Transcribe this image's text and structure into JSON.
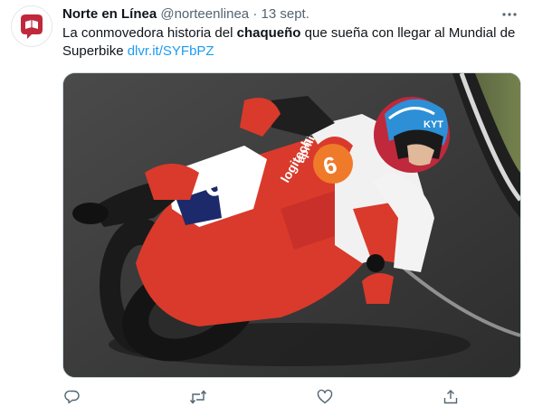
{
  "tweet": {
    "author_name": "Norte en Línea",
    "handle": "@norteenlinea",
    "separator": "·",
    "date": "13 sept.",
    "text_before": "La conmovedora historia del ",
    "text_bold": "chaqueño",
    "text_after": " que sueña con llegar al Mundial de Superbike ",
    "link": "dlvr.it/SYFbPZ"
  },
  "media": {
    "bike_number": "6",
    "helmet_logo": "KYT",
    "sponsor_logo": "logitech",
    "sponsor_brand": "aprilia"
  },
  "icons": {
    "avatar": "norte-en-linea-logo-icon",
    "more": "more-options-icon",
    "reply": "reply-icon",
    "retweet": "retweet-icon",
    "like": "heart-icon",
    "share": "share-icon"
  },
  "colors": {
    "brand": "#c0283c",
    "link": "#1d9bf0",
    "icon_gray": "#536471"
  }
}
